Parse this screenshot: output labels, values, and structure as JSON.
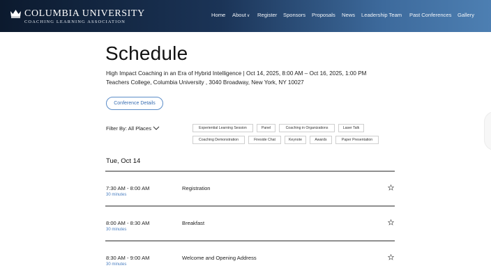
{
  "header": {
    "brand_name": "COLUMBIA UNIVERSITY",
    "brand_sub": "COACHING LEARNING ASSOCIATION",
    "nav": [
      {
        "label": "Home"
      },
      {
        "label": "About",
        "caret": "∨"
      },
      {
        "label": "Register"
      },
      {
        "label": "Sponsors"
      },
      {
        "label": "Proposals"
      },
      {
        "label": "News"
      },
      {
        "label": "Leadership Team"
      },
      {
        "label": "Past Conferences"
      },
      {
        "label": "Gallery"
      }
    ]
  },
  "page": {
    "title": "Schedule",
    "subtitle_line1": "High Impact Coaching in an Era of Hybrid Intelligence | Oct 14, 2025, 8:00 AM – Oct 16, 2025, 1:00 PM",
    "subtitle_line2": "Teachers College, Columbia University , 3040 Broadway, New York, NY 10027",
    "details_button": "Conference Details"
  },
  "filter": {
    "label": "Filter By: All Places",
    "tags_row1": [
      "Experiential Learning Session",
      "Panel",
      "Coaching in Organizations",
      "Laser Talk"
    ],
    "tags_row2": [
      "Coaching Demonstration",
      "Fireside Chat",
      "Keynote",
      "Awards",
      "Paper Presentation"
    ]
  },
  "schedule": {
    "day": "Tue, Oct 14",
    "items": [
      {
        "time": "7:30 AM - 8:00 AM",
        "duration": "30 minutes",
        "title": "Registration"
      },
      {
        "time": "8:00 AM - 8:30 AM",
        "duration": "30 minutes",
        "title": "Breakfast"
      },
      {
        "time": "8:30 AM - 9:00 AM",
        "duration": "30 minutes",
        "title": "Welcome and Opening Address"
      }
    ]
  },
  "colors": {
    "header_dark": "#0c1a2e",
    "header_light": "#4d7fb2",
    "accent_blue": "#4a7fc1"
  }
}
